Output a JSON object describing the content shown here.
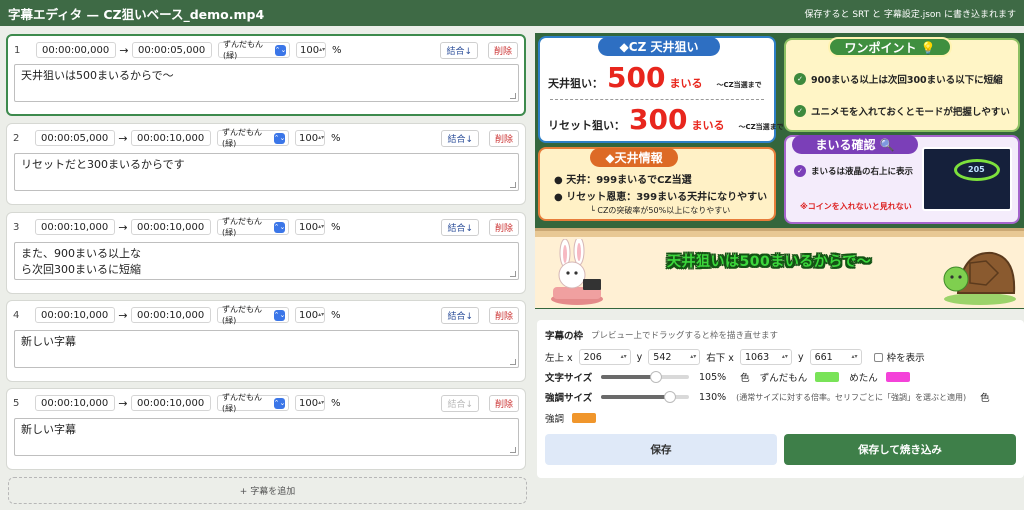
{
  "header": {
    "title": "字幕エディタ — CZ狙いベース_demo.mp4",
    "notice": "保存すると SRT と 字幕設定.json に書き込まれます"
  },
  "icons": {
    "arrow": "→",
    "select_chevron": "⌃⌄",
    "spinner": "▴▾",
    "check": "✓",
    "plus": "+",
    "grip": "resize-grip"
  },
  "subtitles": [
    {
      "index": "1",
      "start": "00:00:00,000",
      "end": "00:00:05,000",
      "speaker": "ずんだもん(緑)",
      "size": "100",
      "unit": "%",
      "merge_label": "結合↓",
      "merge_enabled": true,
      "delete_label": "削除",
      "text": "天井狙いは500まいるからで〜"
    },
    {
      "index": "2",
      "start": "00:00:05,000",
      "end": "00:00:10,000",
      "speaker": "ずんだもん(緑)",
      "size": "100",
      "unit": "%",
      "merge_label": "結合↓",
      "merge_enabled": true,
      "delete_label": "削除",
      "text": "リセットだと300まいるからです"
    },
    {
      "index": "3",
      "start": "00:00:10,000",
      "end": "00:00:10,000",
      "speaker": "ずんだもん(緑)",
      "size": "100",
      "unit": "%",
      "merge_label": "結合↓",
      "merge_enabled": true,
      "delete_label": "削除",
      "text": "また、900まいる以上な\nら次回300まいるに短縮"
    },
    {
      "index": "4",
      "start": "00:00:10,000",
      "end": "00:00:10,000",
      "speaker": "ずんだもん(緑)",
      "size": "100",
      "unit": "%",
      "merge_label": "結合↓",
      "merge_enabled": true,
      "delete_label": "削除",
      "text": "新しい字幕"
    },
    {
      "index": "5",
      "start": "00:00:10,000",
      "end": "00:00:10,000",
      "speaker": "ずんだもん(緑)",
      "size": "100",
      "unit": "%",
      "merge_label": "結合↓",
      "merge_enabled": false,
      "delete_label": "削除",
      "text": "新しい字幕"
    }
  ],
  "add_button": "+ 字幕を追加",
  "preview": {
    "cz": {
      "title": "◆CZ 天井狙い",
      "row1_label": "天井狙い：",
      "row1_value": "500",
      "row1_unit": "まいる",
      "row1_note": "〜CZ当選まで",
      "row2_label": "リセット狙い：",
      "row2_value": "300",
      "row2_unit": "まいる",
      "row2_note": "〜CZ当選まで"
    },
    "point": {
      "title": "ワンポイント 💡",
      "tip1": "900まいる以上は次回300まいる以下に短縮",
      "tip2": "ユニメモを入れておくとモードが把握しやすい"
    },
    "info": {
      "title": "◆天井情報",
      "line1": "●  天井：999まいるでCZ当選",
      "line2": "●  リセット恩恵：399まいる天井になりやすい",
      "line3": "└ CZの突破率が50%以上になりやすい"
    },
    "confirm": {
      "title": "まいる確認 🔍",
      "line1": "まいるは液晶の右上に表示",
      "line2": "※コインを入れないと見れない",
      "photo_number": "205"
    },
    "caption": "天井狙いは500まいるからで〜"
  },
  "frame_panel": {
    "title": "字幕の枠",
    "hint": "プレビュー上でドラッグすると枠を描き直せます",
    "tl_label": "左上 x",
    "tl_x": "206",
    "y_label": "y",
    "tl_y": "542",
    "br_label": "右下 x",
    "br_x": "1063",
    "br_y": "661",
    "show_label": "枠を表示",
    "text_size_label": "文字サイズ",
    "text_size": "105%",
    "text_size_value": 0.62,
    "color_label": "色",
    "zunda_label": "ずんだもん",
    "zunda_color": "#79e358",
    "metan_label": "めたん",
    "metan_color": "#f442d9",
    "emph_label": "強調サイズ",
    "emph_size": "130%",
    "emph_size_value": 0.78,
    "emph_hint": "(通常サイズに対する倍率。セリフごとに「強調」を選ぶと適用)",
    "emph_color_label": "色",
    "emph_word": "強調",
    "emph_color": "#f0962c",
    "save": "保存",
    "save_burn": "保存して焼き込み"
  }
}
